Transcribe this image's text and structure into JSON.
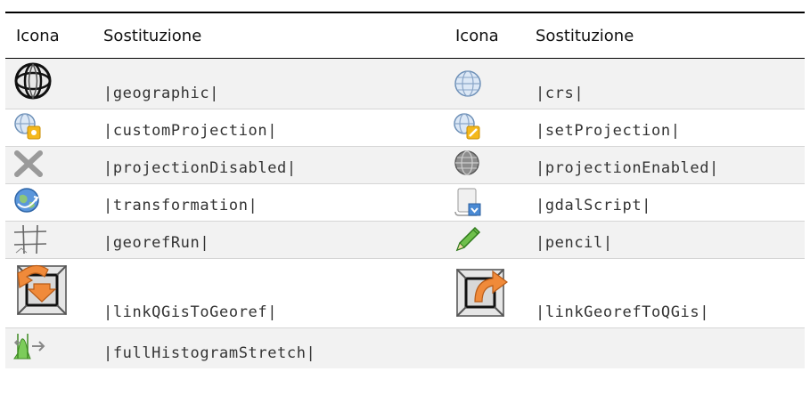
{
  "header": {
    "icon_col": "Icona",
    "sub_col": "Sostituzione"
  },
  "rows": [
    {
      "left": {
        "icon": "globe-wireframe-icon",
        "sub": "|geographic|"
      },
      "right": {
        "icon": "globe-grid-icon",
        "sub": "|crs|"
      }
    },
    {
      "left": {
        "icon": "globe-custom-projection-icon",
        "sub": "|customProjection|"
      },
      "right": {
        "icon": "globe-set-projection-icon",
        "sub": "|setProjection|"
      }
    },
    {
      "left": {
        "icon": "projection-disabled-x-icon",
        "sub": "|projectionDisabled|"
      },
      "right": {
        "icon": "projection-enabled-globe-icon",
        "sub": "|projectionEnabled|"
      }
    },
    {
      "left": {
        "icon": "transformation-globe-icon",
        "sub": "|transformation|"
      },
      "right": {
        "icon": "gdal-script-icon",
        "sub": "|gdalScript|"
      }
    },
    {
      "left": {
        "icon": "georef-grid-icon",
        "sub": "|georefRun|"
      },
      "right": {
        "icon": "pencil-icon",
        "sub": "|pencil|"
      }
    },
    {
      "left": {
        "icon": "link-qgis-to-georef-icon",
        "sub": "|linkQGisToGeoref|"
      },
      "right": {
        "icon": "link-georef-to-qgis-icon",
        "sub": "|linkGeorefToQGis|"
      }
    },
    {
      "left": {
        "icon": "full-histogram-stretch-icon",
        "sub": "|fullHistogramStretch|"
      },
      "right": {
        "icon": "",
        "sub": ""
      }
    }
  ],
  "colors": {
    "header_rule": "#000000",
    "row_alt": "#f2f2f2",
    "orange": "#f08a3a",
    "globe_blue": "#4f8fd6"
  }
}
